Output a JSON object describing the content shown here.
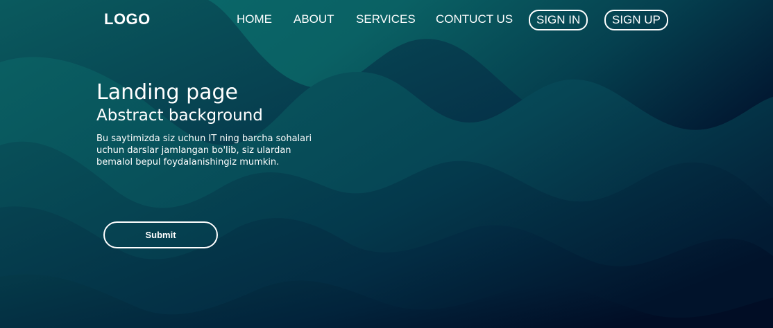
{
  "header": {
    "logo": "LOGO",
    "nav": {
      "home": "HOME",
      "about": "ABOUT",
      "services": "SERVICES",
      "contact": "CONTUCT US",
      "sign_in": "SIGN IN",
      "sign_up": "SIGN UP"
    }
  },
  "hero": {
    "title": "Landing page",
    "subtitle": "Abstract background",
    "description": "Bu saytimizda siz uchun IT ning barcha sohalari uchun darslar jamlangan bo'lib, siz ulardan bemalol bepul foydalanishingiz mumkin.",
    "submit_label": "Submit"
  },
  "theme": {
    "wave_light": "#0b6466",
    "wave_mid": "#05404f",
    "wave_dark": "#021a33",
    "text": "#ffffff"
  }
}
